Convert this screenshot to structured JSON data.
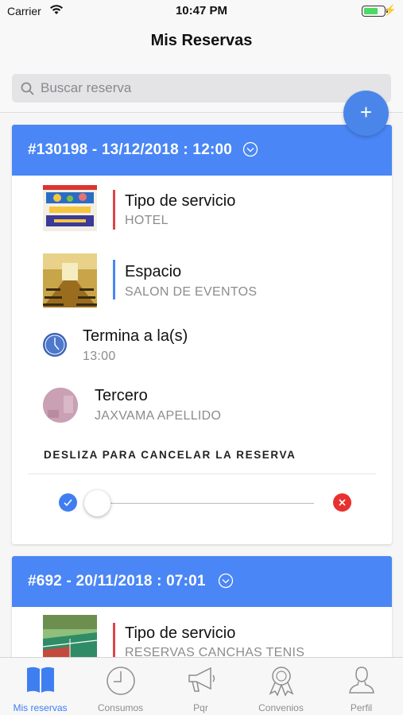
{
  "status_bar": {
    "carrier": "Carrier",
    "time": "10:47 PM",
    "battery_level": 0.65
  },
  "header": {
    "title": "Mis Reservas"
  },
  "search": {
    "placeholder": "Buscar reserva"
  },
  "fab": {
    "label": "+"
  },
  "reservations": [
    {
      "title": "#130198 - 13/12/2018 : 12:00",
      "service_label": "Tipo de servicio",
      "service_value": "HOTEL",
      "space_label": "Espacio",
      "space_value": "SALON DE EVENTOS",
      "ends_label": "Termina a la(s)",
      "ends_value": "13:00",
      "third_label": "Tercero",
      "third_value": "JAXVAMA APELLIDO",
      "swipe_label": "DESLIZA PARA CANCELAR LA RESERVA"
    },
    {
      "title": "#692 - 20/11/2018 : 07:01",
      "service_label": "Tipo de servicio",
      "service_value": "RESERVAS CANCHAS TENIS"
    }
  ],
  "colors": {
    "accent": "#4a86f5",
    "service_bar": "#e0444a",
    "space_bar": "#4a86f5",
    "cancel": "#e8312f"
  },
  "tabs": [
    {
      "label": "Mis reservas",
      "icon": "book-icon",
      "active": true
    },
    {
      "label": "Consumos",
      "icon": "clock-icon",
      "active": false
    },
    {
      "label": "Pqr",
      "icon": "megaphone-icon",
      "active": false
    },
    {
      "label": "Convenios",
      "icon": "award-icon",
      "active": false
    },
    {
      "label": "Perfil",
      "icon": "user-icon",
      "active": false
    }
  ]
}
